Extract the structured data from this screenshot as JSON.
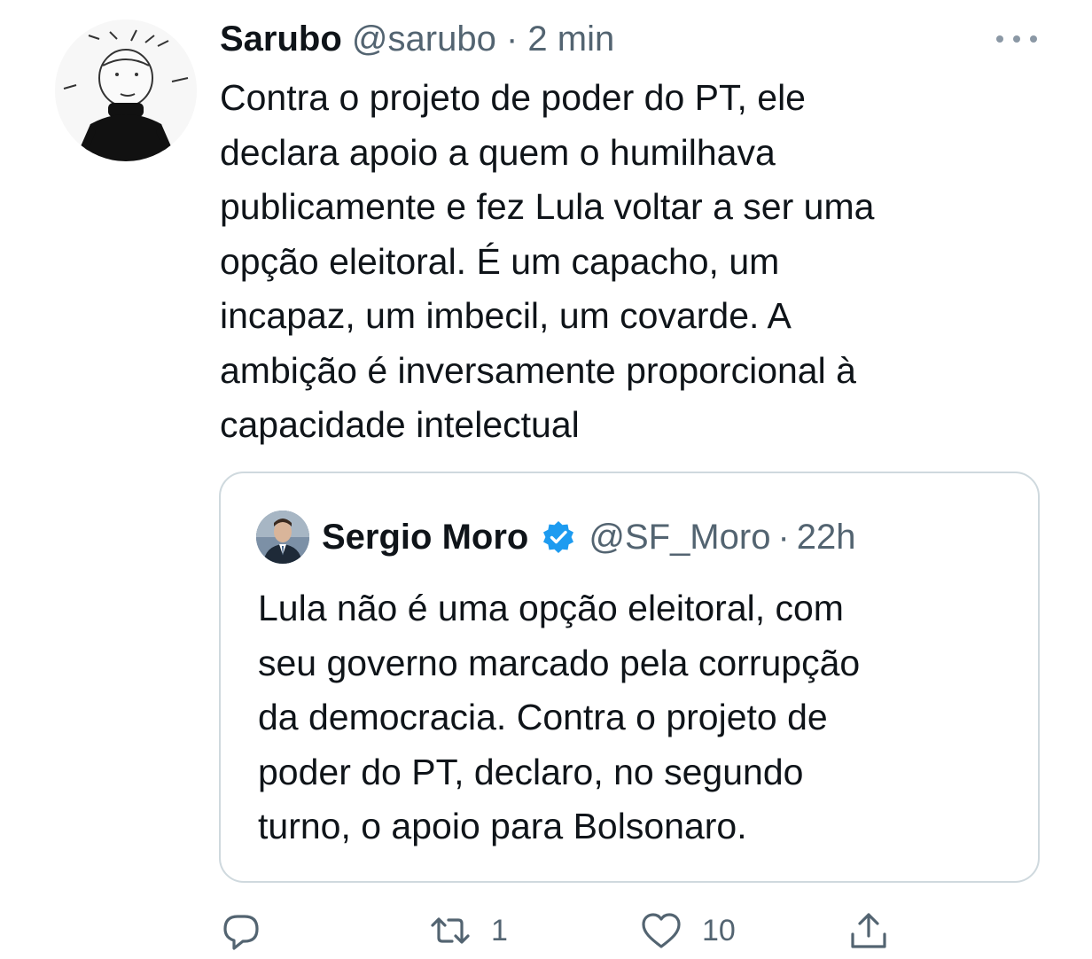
{
  "tweet": {
    "display_name": "Sarubo",
    "handle": "@sarubo",
    "separator": "·",
    "time": "2 min",
    "avatar_icon": "cartoon-person-avatar",
    "text_lines": [
      "Contra o projeto de poder do PT, ele",
      "declara apoio a quem o humilhava",
      "publicamente e fez Lula voltar a ser uma",
      "opção eleitoral. É um capacho, um",
      "incapaz, um imbecil, um covarde. A",
      "ambição é inversamente proporcional à",
      "capacidade intelectual"
    ]
  },
  "quoted": {
    "display_name": "Sergio Moro",
    "verified_icon": "verified-badge-icon",
    "handle": "@SF_Moro",
    "separator": "·",
    "time": "22h",
    "text_lines": [
      "Lula não é uma opção eleitoral, com",
      "seu governo marcado pela corrupção",
      "da democracia. Contra o projeto de",
      "poder do PT, declaro, no segundo",
      "turno, o apoio para Bolsonaro."
    ]
  },
  "actions": {
    "reply_icon": "reply-icon",
    "retweet_icon": "retweet-icon",
    "retweet_count": "1",
    "like_icon": "heart-icon",
    "like_count": "10",
    "share_icon": "share-icon"
  },
  "colors": {
    "text": "#0f1419",
    "muted": "#536471",
    "border": "#cfd9de",
    "verified": "#1d9bf0"
  }
}
